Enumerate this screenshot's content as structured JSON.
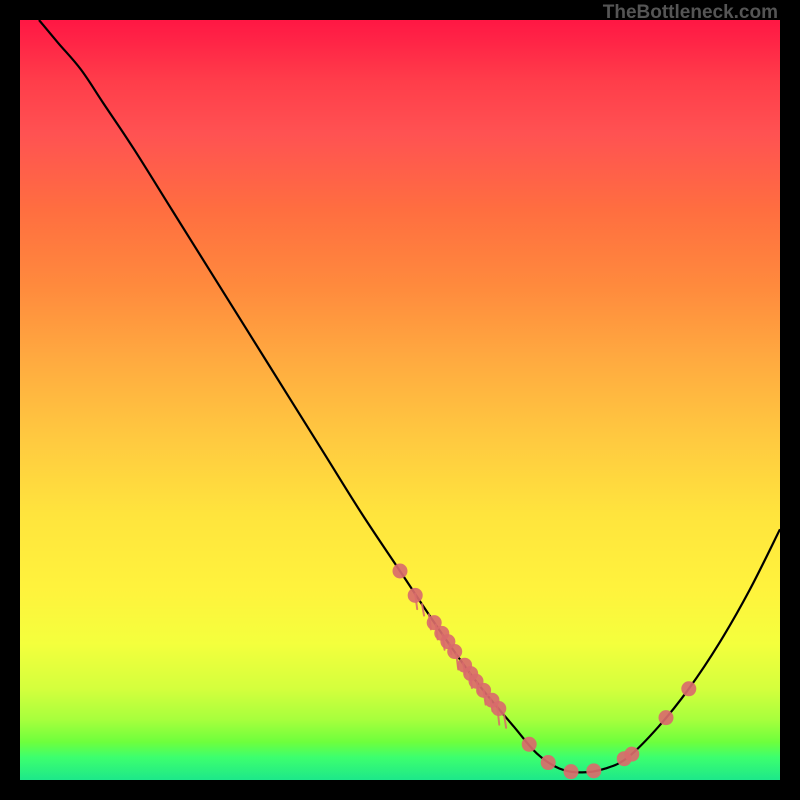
{
  "watermark": "TheBottleneck.com",
  "chart_data": {
    "type": "line",
    "title": "",
    "xlabel": "",
    "ylabel": "",
    "xlim": [
      0,
      100
    ],
    "ylim": [
      0,
      100
    ],
    "curve": {
      "name": "bottleneck-curve",
      "note": "x is normalized horizontal position 0–100, y is normalized height 0–100 where 0 is bottom (green) and 100 is top (red). Curve descends from upper-left, reaches minimum near x≈74, rises again toward right.",
      "points": [
        {
          "x": 2.5,
          "y": 100
        },
        {
          "x": 5,
          "y": 97
        },
        {
          "x": 8,
          "y": 93.5
        },
        {
          "x": 11,
          "y": 89
        },
        {
          "x": 15,
          "y": 83
        },
        {
          "x": 20,
          "y": 75
        },
        {
          "x": 25,
          "y": 67
        },
        {
          "x": 30,
          "y": 59
        },
        {
          "x": 35,
          "y": 51
        },
        {
          "x": 40,
          "y": 43
        },
        {
          "x": 45,
          "y": 35
        },
        {
          "x": 50,
          "y": 27.5
        },
        {
          "x": 55,
          "y": 20
        },
        {
          "x": 60,
          "y": 13
        },
        {
          "x": 65,
          "y": 7
        },
        {
          "x": 68,
          "y": 3.5
        },
        {
          "x": 71,
          "y": 1.5
        },
        {
          "x": 74,
          "y": 1
        },
        {
          "x": 77,
          "y": 1.5
        },
        {
          "x": 80,
          "y": 3
        },
        {
          "x": 84,
          "y": 7
        },
        {
          "x": 88,
          "y": 12
        },
        {
          "x": 92,
          "y": 18
        },
        {
          "x": 96,
          "y": 25
        },
        {
          "x": 100,
          "y": 33
        }
      ]
    },
    "scatter": {
      "name": "data-points",
      "color": "#d96b6b",
      "note": "Salmon-colored circular markers placed along the curve, concentrated on the descending slope (approx x 50–63) and around/near the minimum and ascending side.",
      "points": [
        {
          "x": 50,
          "y": 27.5
        },
        {
          "x": 52,
          "y": 24.3
        },
        {
          "x": 54.5,
          "y": 20.7
        },
        {
          "x": 55.5,
          "y": 19.3
        },
        {
          "x": 56.3,
          "y": 18.2
        },
        {
          "x": 57.2,
          "y": 16.9
        },
        {
          "x": 58.5,
          "y": 15.1
        },
        {
          "x": 59.3,
          "y": 14
        },
        {
          "x": 60,
          "y": 13
        },
        {
          "x": 61,
          "y": 11.8
        },
        {
          "x": 62.1,
          "y": 10.5
        },
        {
          "x": 63,
          "y": 9.4
        },
        {
          "x": 67,
          "y": 4.7
        },
        {
          "x": 69.5,
          "y": 2.3
        },
        {
          "x": 72.5,
          "y": 1.1
        },
        {
          "x": 75.5,
          "y": 1.2
        },
        {
          "x": 79.5,
          "y": 2.8
        },
        {
          "x": 80.5,
          "y": 3.4
        },
        {
          "x": 85,
          "y": 8.2
        },
        {
          "x": 88,
          "y": 12
        }
      ]
    },
    "descending_segment_hatching": {
      "note": "Short downward-right tick marks (comb/hatching) on the inner side of the descending slope roughly over x 52–64, suggesting small vertical drop/spread from the markers.",
      "present": true
    }
  }
}
